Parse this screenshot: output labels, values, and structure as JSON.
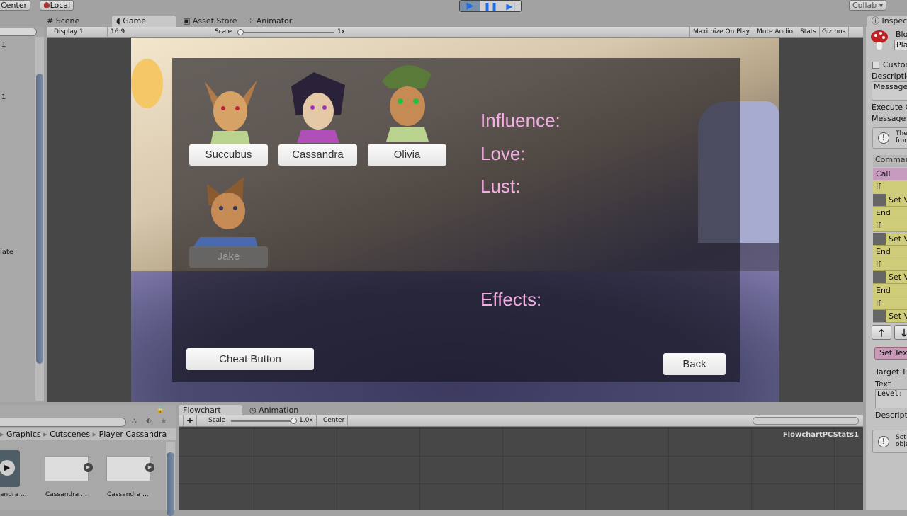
{
  "toolbar": {
    "center": "Center",
    "local": "Local",
    "collab": "Collab ▾",
    "play_icon": "play-icon",
    "pause_icon": "pause-icon",
    "step_icon": "step-icon"
  },
  "tabs": {
    "scene": "Scene",
    "game": "Game",
    "asset_store": "Asset Store",
    "animator": "Animator",
    "inspector": "Inspect"
  },
  "game_toolbar": {
    "display": "Display 1",
    "aspect": "16:9",
    "scale_label": "Scale",
    "scale_value": "1x",
    "maximize": "Maximize On Play",
    "mute": "Mute Audio",
    "stats": "Stats",
    "gizmos": "Gizmos"
  },
  "hierarchy": {
    "items": [
      "1",
      "1",
      "iate"
    ]
  },
  "game": {
    "characters": [
      {
        "name": "Succubus"
      },
      {
        "name": "Cassandra"
      },
      {
        "name": "Olivia"
      },
      {
        "name": "Jake"
      }
    ],
    "stats": {
      "influence": "Influence:",
      "love": "Love:",
      "lust": "Lust:",
      "effects": "Effects:"
    },
    "cheat_button": "Cheat Button",
    "back_button": "Back"
  },
  "inspector": {
    "title": "Blo",
    "field": "Pla",
    "custom": "Custor",
    "description": "Descriptio",
    "message_box": "Message:",
    "execute": "Execute C",
    "message": "Message",
    "info1": "The",
    "info2": "from",
    "commands_header": "Commar",
    "commands": [
      {
        "label": "Call",
        "type": "call"
      },
      {
        "label": "If",
        "type": "if"
      },
      {
        "label": "Set V",
        "type": "set"
      },
      {
        "label": "End",
        "type": "if"
      },
      {
        "label": "If",
        "type": "if"
      },
      {
        "label": "Set V",
        "type": "set"
      },
      {
        "label": "End",
        "type": "if"
      },
      {
        "label": "If",
        "type": "if"
      },
      {
        "label": "Set V",
        "type": "set"
      },
      {
        "label": "End",
        "type": "if"
      },
      {
        "label": "If",
        "type": "if"
      },
      {
        "label": "Set V",
        "type": "set"
      }
    ],
    "selected_command": "Set Tex",
    "target": "Target T",
    "text_label": "Text",
    "text_value": "Level: {$",
    "description2": "Descripti",
    "info3": "Set",
    "info4": "obje"
  },
  "project": {
    "breadcrumb": [
      "Graphics",
      "Cutscenes",
      "Player Cassandra"
    ],
    "assets": [
      "andra ...",
      "Cassandra ...",
      "Cassandra ..."
    ]
  },
  "flowchart": {
    "tab": "Flowchart",
    "animation_tab": "Animation",
    "add": "+",
    "scale_label": "Scale",
    "scale_value": "1.0x",
    "center": "Center",
    "name": "FlowchartPCStats1"
  }
}
